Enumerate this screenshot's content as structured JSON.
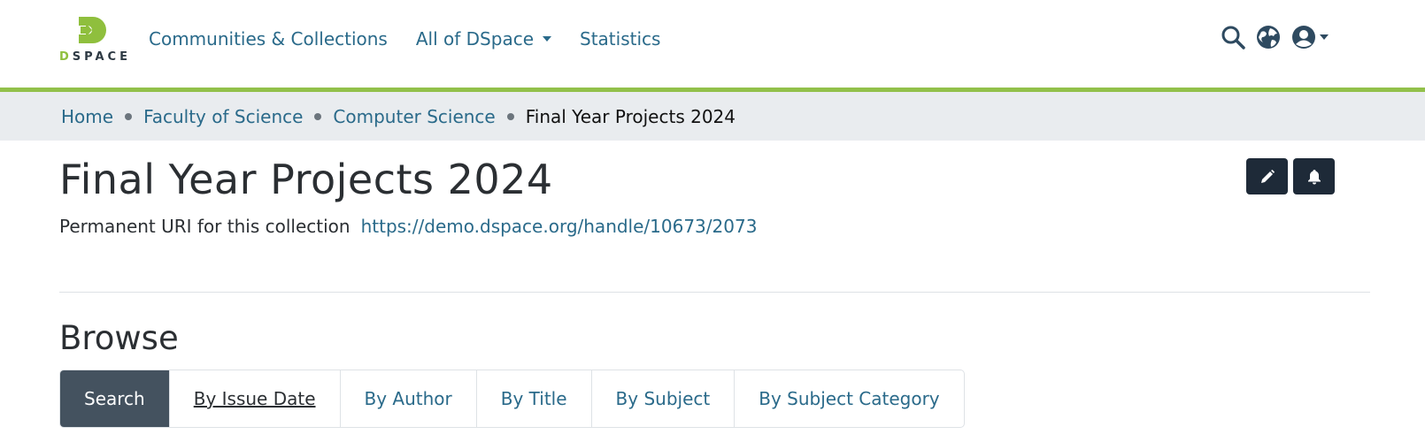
{
  "header": {
    "logo_text_prefix": "D",
    "logo_text_rest": "SPACE",
    "nav": [
      {
        "label": "Communities & Collections",
        "has_caret": false
      },
      {
        "label": "All of DSpace",
        "has_caret": true
      },
      {
        "label": "Statistics",
        "has_caret": false
      }
    ],
    "icons": [
      "search-icon",
      "language-icon",
      "user-icon"
    ]
  },
  "breadcrumb": {
    "items": [
      "Home",
      "Faculty of Science",
      "Computer Science"
    ],
    "current": "Final Year Projects 2024"
  },
  "page": {
    "title": "Final Year Projects 2024",
    "uri_label": "Permanent URI for this collection",
    "uri_value": "https://demo.dspace.org/handle/10673/2073",
    "actions": [
      "edit-icon",
      "bell-icon"
    ]
  },
  "browse": {
    "heading": "Browse",
    "tabs": [
      "Search",
      "By Issue Date",
      "By Author",
      "By Title",
      "By Subject",
      "By Subject Category"
    ],
    "active_tab": "Search",
    "hover_tab": "By Issue Date"
  },
  "colors": {
    "accent_green": "#92c04a",
    "link": "#2a6a8a",
    "dark_button": "#1e2a38",
    "active_tab": "#44525f"
  }
}
